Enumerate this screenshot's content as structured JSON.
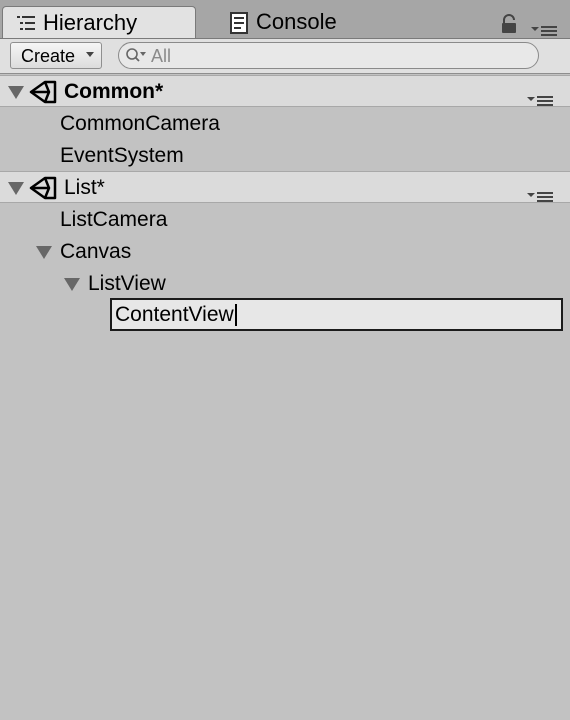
{
  "tabs": {
    "hierarchy_label": "Hierarchy",
    "console_label": "Console"
  },
  "toolbar": {
    "create_label": "Create",
    "search_placeholder": "All"
  },
  "scenes": [
    {
      "name": "Common*",
      "bold": true,
      "children": [
        {
          "label": "CommonCamera"
        },
        {
          "label": "EventSystem"
        }
      ]
    },
    {
      "name": "List*",
      "bold": false,
      "children": [
        {
          "label": "ListCamera"
        },
        {
          "label": "Canvas"
        },
        {
          "label": "ListView"
        }
      ]
    }
  ],
  "rename_field": {
    "value": "ContentView"
  },
  "icons": {
    "hierarchy": "list-icon",
    "console": "console-icon",
    "lock": "lock-icon",
    "scene": "unity-logo-icon",
    "menu": "context-menu-icon",
    "search": "search-icon"
  },
  "colors": {
    "background": "#c2c2c2",
    "scene_header": "#dbdbdb",
    "tabbar": "#a6a6a6"
  }
}
